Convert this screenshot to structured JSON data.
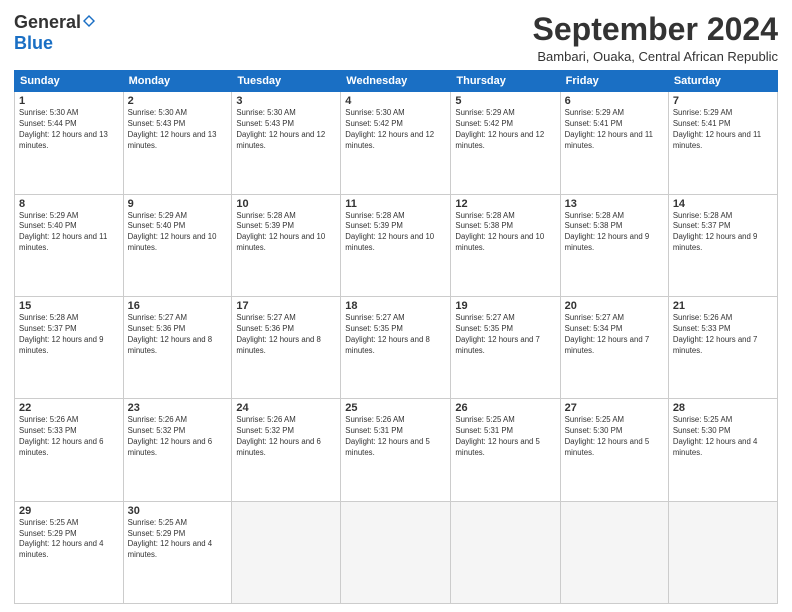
{
  "logo": {
    "general": "General",
    "blue": "Blue"
  },
  "title": "September 2024",
  "location": "Bambari, Ouaka, Central African Republic",
  "days_header": [
    "Sunday",
    "Monday",
    "Tuesday",
    "Wednesday",
    "Thursday",
    "Friday",
    "Saturday"
  ],
  "weeks": [
    [
      {
        "day": "1",
        "sunrise": "5:30 AM",
        "sunset": "5:44 PM",
        "daylight": "12 hours and 13 minutes."
      },
      {
        "day": "2",
        "sunrise": "5:30 AM",
        "sunset": "5:43 PM",
        "daylight": "12 hours and 13 minutes."
      },
      {
        "day": "3",
        "sunrise": "5:30 AM",
        "sunset": "5:43 PM",
        "daylight": "12 hours and 12 minutes."
      },
      {
        "day": "4",
        "sunrise": "5:30 AM",
        "sunset": "5:42 PM",
        "daylight": "12 hours and 12 minutes."
      },
      {
        "day": "5",
        "sunrise": "5:29 AM",
        "sunset": "5:42 PM",
        "daylight": "12 hours and 12 minutes."
      },
      {
        "day": "6",
        "sunrise": "5:29 AM",
        "sunset": "5:41 PM",
        "daylight": "12 hours and 11 minutes."
      },
      {
        "day": "7",
        "sunrise": "5:29 AM",
        "sunset": "5:41 PM",
        "daylight": "12 hours and 11 minutes."
      }
    ],
    [
      {
        "day": "8",
        "sunrise": "5:29 AM",
        "sunset": "5:40 PM",
        "daylight": "12 hours and 11 minutes."
      },
      {
        "day": "9",
        "sunrise": "5:29 AM",
        "sunset": "5:40 PM",
        "daylight": "12 hours and 10 minutes."
      },
      {
        "day": "10",
        "sunrise": "5:28 AM",
        "sunset": "5:39 PM",
        "daylight": "12 hours and 10 minutes."
      },
      {
        "day": "11",
        "sunrise": "5:28 AM",
        "sunset": "5:39 PM",
        "daylight": "12 hours and 10 minutes."
      },
      {
        "day": "12",
        "sunrise": "5:28 AM",
        "sunset": "5:38 PM",
        "daylight": "12 hours and 10 minutes."
      },
      {
        "day": "13",
        "sunrise": "5:28 AM",
        "sunset": "5:38 PM",
        "daylight": "12 hours and 9 minutes."
      },
      {
        "day": "14",
        "sunrise": "5:28 AM",
        "sunset": "5:37 PM",
        "daylight": "12 hours and 9 minutes."
      }
    ],
    [
      {
        "day": "15",
        "sunrise": "5:28 AM",
        "sunset": "5:37 PM",
        "daylight": "12 hours and 9 minutes."
      },
      {
        "day": "16",
        "sunrise": "5:27 AM",
        "sunset": "5:36 PM",
        "daylight": "12 hours and 8 minutes."
      },
      {
        "day": "17",
        "sunrise": "5:27 AM",
        "sunset": "5:36 PM",
        "daylight": "12 hours and 8 minutes."
      },
      {
        "day": "18",
        "sunrise": "5:27 AM",
        "sunset": "5:35 PM",
        "daylight": "12 hours and 8 minutes."
      },
      {
        "day": "19",
        "sunrise": "5:27 AM",
        "sunset": "5:35 PM",
        "daylight": "12 hours and 7 minutes."
      },
      {
        "day": "20",
        "sunrise": "5:27 AM",
        "sunset": "5:34 PM",
        "daylight": "12 hours and 7 minutes."
      },
      {
        "day": "21",
        "sunrise": "5:26 AM",
        "sunset": "5:33 PM",
        "daylight": "12 hours and 7 minutes."
      }
    ],
    [
      {
        "day": "22",
        "sunrise": "5:26 AM",
        "sunset": "5:33 PM",
        "daylight": "12 hours and 6 minutes."
      },
      {
        "day": "23",
        "sunrise": "5:26 AM",
        "sunset": "5:32 PM",
        "daylight": "12 hours and 6 minutes."
      },
      {
        "day": "24",
        "sunrise": "5:26 AM",
        "sunset": "5:32 PM",
        "daylight": "12 hours and 6 minutes."
      },
      {
        "day": "25",
        "sunrise": "5:26 AM",
        "sunset": "5:31 PM",
        "daylight": "12 hours and 5 minutes."
      },
      {
        "day": "26",
        "sunrise": "5:25 AM",
        "sunset": "5:31 PM",
        "daylight": "12 hours and 5 minutes."
      },
      {
        "day": "27",
        "sunrise": "5:25 AM",
        "sunset": "5:30 PM",
        "daylight": "12 hours and 5 minutes."
      },
      {
        "day": "28",
        "sunrise": "5:25 AM",
        "sunset": "5:30 PM",
        "daylight": "12 hours and 4 minutes."
      }
    ],
    [
      {
        "day": "29",
        "sunrise": "5:25 AM",
        "sunset": "5:29 PM",
        "daylight": "12 hours and 4 minutes."
      },
      {
        "day": "30",
        "sunrise": "5:25 AM",
        "sunset": "5:29 PM",
        "daylight": "12 hours and 4 minutes."
      },
      null,
      null,
      null,
      null,
      null
    ]
  ]
}
